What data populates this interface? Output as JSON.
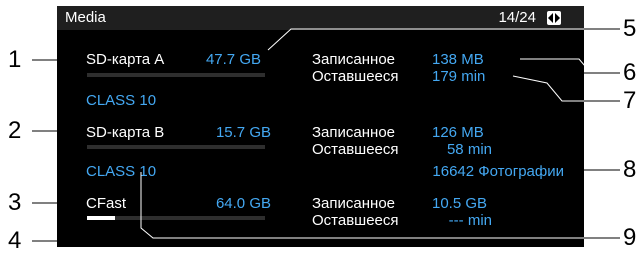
{
  "header": {
    "title": "Media",
    "page": "14/24",
    "page_icon": "left-right-arrows-icon"
  },
  "media": [
    {
      "name": "SD-карта A",
      "capacity": "47.7 GB",
      "class_label": "CLASS 10",
      "recorded_label": "Записанное",
      "recorded_value": "138 MB",
      "remaining_label": "Оставшееся",
      "remaining_value": "179 min",
      "usage_fraction": 0.0
    },
    {
      "name": "SD-карта B",
      "capacity": "15.7 GB",
      "class_label": "CLASS 10",
      "recorded_label": "Записанное",
      "recorded_value": "126 MB",
      "remaining_label": "Оставшееся",
      "remaining_value": "58 min",
      "photos_value": "16642 Фотографии",
      "usage_fraction": 0.0
    },
    {
      "name": "CFast",
      "capacity": "64.0 GB",
      "recorded_label": "Записанное",
      "recorded_value": "10.5 GB",
      "remaining_label": "Оставшееся",
      "remaining_value": "--- min",
      "usage_fraction": 0.16
    }
  ],
  "callouts": [
    "1",
    "2",
    "3",
    "4",
    "5",
    "6",
    "7",
    "8",
    "9"
  ],
  "colors": {
    "value_text": "#44a8f2",
    "label_text": "#ffffff",
    "screen_bg": "#000000",
    "header_bg": "#1f1f1f"
  }
}
